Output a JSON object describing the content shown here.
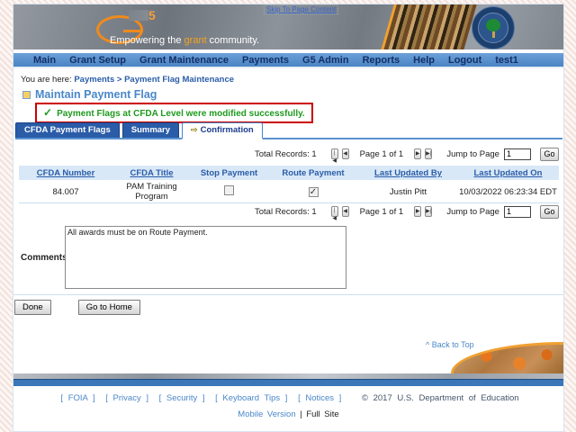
{
  "header": {
    "skip_link": "Skip To Page Content",
    "logo_five": "5",
    "tagline_pre": "Empowering the ",
    "tagline_highlight": "grant",
    "tagline_post": " community."
  },
  "nav": {
    "items": [
      "Main",
      "Grant Setup",
      "Grant Maintenance",
      "Payments",
      "G5 Admin",
      "Reports",
      "Help",
      "Logout",
      "test1"
    ]
  },
  "breadcrumb": {
    "prefix": "You are here:",
    "link1": "Payments",
    "separator": ">",
    "link2": "Payment Flag Maintenance"
  },
  "page": {
    "title": "Maintain Payment Flag",
    "success_check": "✓",
    "success_message": "Payment Flags at CFDA Level were modified successfully."
  },
  "tabs": [
    {
      "label": "CFDA Payment Flags",
      "active": false
    },
    {
      "label": "Summary",
      "active": false
    },
    {
      "label": "Confirmation",
      "active": true,
      "icon": "⇨"
    }
  ],
  "pagination": {
    "total_records": "Total Records: 1",
    "page_of": "Page 1 of 1",
    "jump_label": "Jump to Page",
    "jump_value": "1",
    "go_label": "Go",
    "first_icon": "|◀",
    "prev_icon": "◀",
    "next_icon": "▶",
    "last_icon": "▶|"
  },
  "table": {
    "headers": [
      {
        "label": "CFDA Number"
      },
      {
        "label": "CFDA Title"
      },
      {
        "label": "Stop Payment"
      },
      {
        "label": "Route Payment"
      },
      {
        "label": "Last Updated By"
      },
      {
        "label": "Last Updated On"
      }
    ],
    "rows": [
      {
        "cfda_number": "84.007",
        "cfda_title": "PAM Training Program",
        "stop_payment": false,
        "route_payment": true,
        "last_updated_by": "Justin Pitt",
        "last_updated_on": "10/03/2022 06:23:34 EDT"
      }
    ]
  },
  "comments": {
    "label": "Comments",
    "value": "All awards must be on Route Payment."
  },
  "actions": {
    "done": "Done",
    "go_home": "Go to Home"
  },
  "back_to_top": "^ Back to Top",
  "footer": {
    "links": [
      "[ FOIA ]",
      "[ Privacy ]",
      "[ Security ]",
      "[ Keyboard Tips ]",
      "[ Notices ]"
    ],
    "copyright": "© 2017 U.S. Department of Education",
    "mobile_link": "Mobile Version",
    "pipe": "|",
    "full_site": "Full Site"
  }
}
